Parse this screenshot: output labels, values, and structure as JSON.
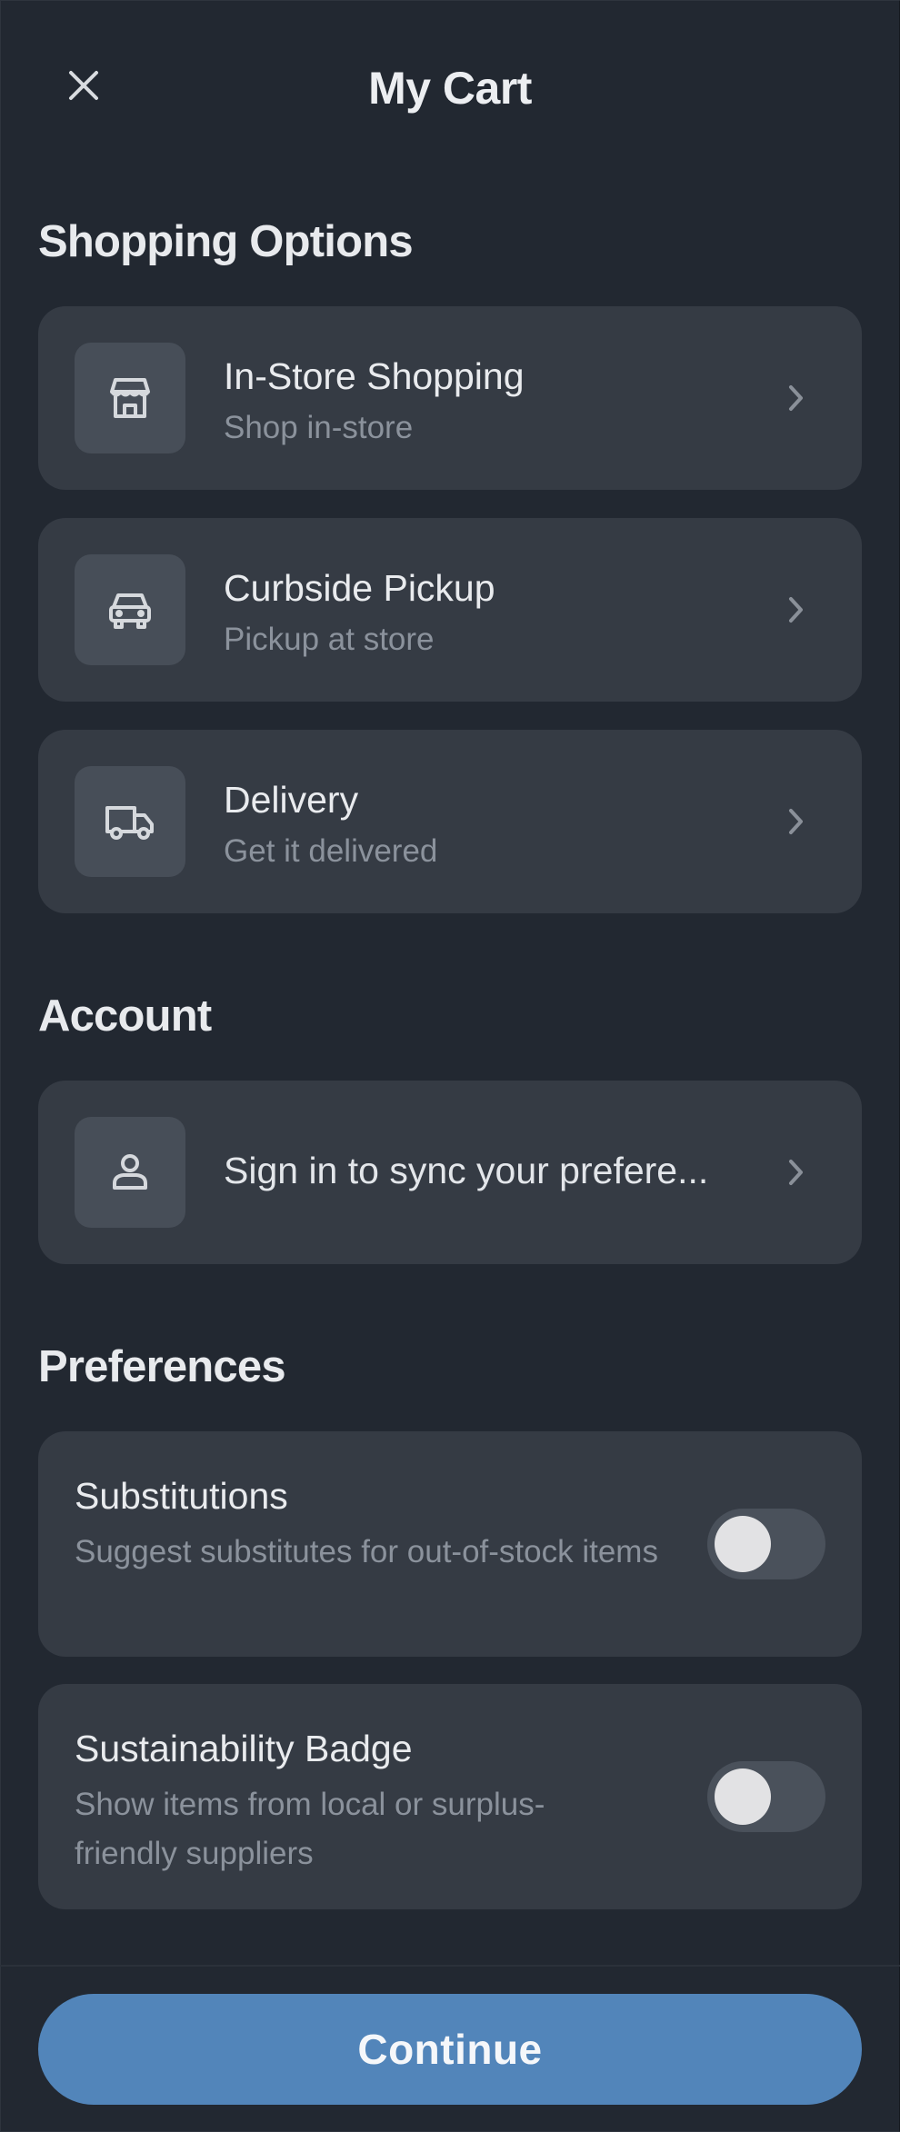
{
  "header": {
    "title": "My Cart",
    "close_icon": "close-icon"
  },
  "shopping_options": {
    "heading": "Shopping Options",
    "items": [
      {
        "title": "In-Store Shopping",
        "subtitle": "Shop in-store",
        "icon": "storefront-icon"
      },
      {
        "title": "Curbside Pickup",
        "subtitle": "Pickup at store",
        "icon": "car-icon"
      },
      {
        "title": "Delivery",
        "subtitle": "Get it delivered",
        "icon": "truck-icon"
      }
    ]
  },
  "account": {
    "heading": "Account",
    "sign_in_label": "Sign in to sync your prefere...",
    "icon": "person-icon"
  },
  "preferences": {
    "heading": "Preferences",
    "items": [
      {
        "title": "Substitutions",
        "description": "Suggest substitutes for out-of-stock items",
        "enabled": false
      },
      {
        "title": "Sustainability Badge",
        "description": "Show items from local or surplus-friendly suppliers",
        "enabled": false
      }
    ]
  },
  "footer": {
    "continue_label": "Continue",
    "accent_color": "#5285ba"
  },
  "colors": {
    "background": "#222831",
    "card": "#353b44",
    "icon_tile": "#474e58"
  }
}
